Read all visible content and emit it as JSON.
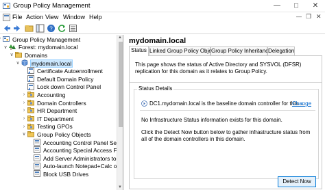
{
  "window": {
    "title": "Group Policy Management"
  },
  "menu": [
    "File",
    "Action",
    "View",
    "Window",
    "Help"
  ],
  "toolbar": [
    "back",
    "forward",
    "up",
    "console-tree",
    "help",
    "refresh",
    "properties"
  ],
  "tree": [
    {
      "label": "Group Policy Management",
      "indent": 0,
      "icon": "gpm-icon",
      "twisty": "down"
    },
    {
      "label": "Forest: mydomain.local",
      "indent": 1,
      "icon": "forest-icon",
      "twisty": "down"
    },
    {
      "label": "Domains",
      "indent": 2,
      "icon": "folder-icon",
      "twisty": "down"
    },
    {
      "label": "mydomain.local",
      "indent": 3,
      "icon": "domain-icon",
      "twisty": "down",
      "selected": true
    },
    {
      "label": "Certificate Autoenrollment",
      "indent": 4,
      "icon": "gpo-link-icon"
    },
    {
      "label": "Default Domain Policy",
      "indent": 4,
      "icon": "gpo-link-icon"
    },
    {
      "label": "Lock down Control Panel",
      "indent": 4,
      "icon": "gpo-link-icon"
    },
    {
      "label": "Accounting",
      "indent": 4,
      "icon": "ou-icon",
      "twisty": "right"
    },
    {
      "label": "Domain Controllers",
      "indent": 4,
      "icon": "ou-icon",
      "twisty": "right"
    },
    {
      "label": "HR Department",
      "indent": 4,
      "icon": "ou-icon",
      "twisty": "right"
    },
    {
      "label": "IT Department",
      "indent": 4,
      "icon": "ou-icon",
      "twisty": "right"
    },
    {
      "label": "Testing GPOs",
      "indent": 4,
      "icon": "ou-icon",
      "twisty": "right"
    },
    {
      "label": "Group Policy Objects",
      "indent": 4,
      "icon": "folder-icon",
      "twisty": "down"
    },
    {
      "label": "Accounting Control Panel Set",
      "indent": 5,
      "icon": "gpo-icon"
    },
    {
      "label": "Accounting Special Access Fi",
      "indent": 5,
      "icon": "gpo-icon"
    },
    {
      "label": "Add Server Administrators to",
      "indent": 5,
      "icon": "gpo-icon"
    },
    {
      "label": "Auto-launch Notepad+Calc o",
      "indent": 5,
      "icon": "gpo-icon"
    },
    {
      "label": "Block USB Drives",
      "indent": 5,
      "icon": "gpo-icon"
    }
  ],
  "details": {
    "domain": "mydomain.local",
    "tabs": [
      "Status",
      "Linked Group Policy Objects",
      "Group Policy Inheritance",
      "Delegation"
    ],
    "active_tab": 0,
    "description": "This page shows the status of Active Directory and SYSVOL (DFSR) replication for this domain as it relates to Group Policy.",
    "status_group_label": "Status Details",
    "baseline_text": "DC1.mydomain.local is the baseline domain controller for this ...",
    "change_link": "Change",
    "no_infra_text": "No Infrastructure Status information exists for this domain.",
    "click_detect_text": "Click the Detect Now button below to gather infrastructure status from all of the domain controllers in this domain.",
    "detect_button": "Detect Now"
  }
}
